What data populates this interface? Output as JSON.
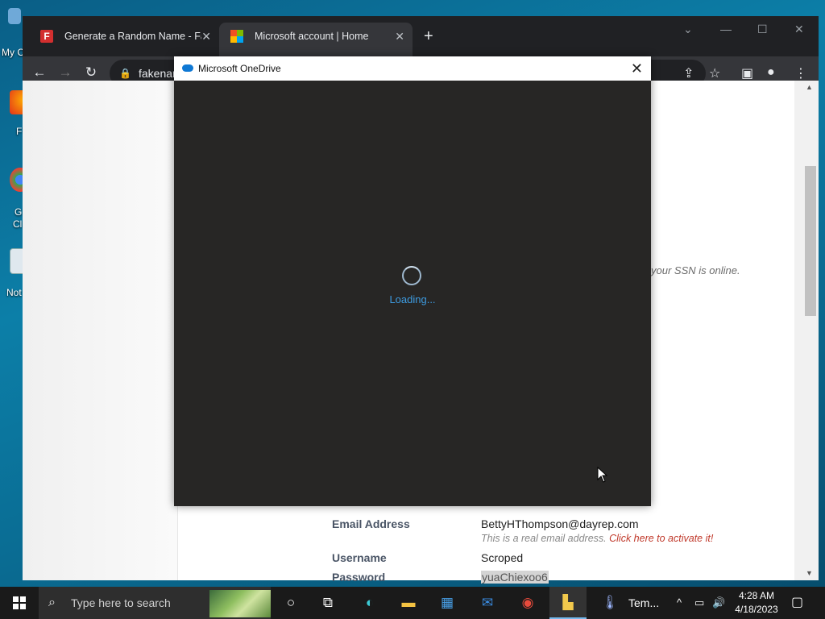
{
  "desktop": {
    "icons": [
      {
        "label": "My C"
      },
      {
        "label": "F"
      },
      {
        "label": "G"
      },
      {
        "label": "Cl"
      },
      {
        "label": "Not"
      }
    ]
  },
  "browser": {
    "tabs": [
      {
        "title": "Generate a Random Name - Fake",
        "favicon": "fakename-f-icon",
        "active": false
      },
      {
        "title": "Microsoft account | Home",
        "favicon": "microsoft-logo-icon",
        "active": true
      }
    ],
    "new_tab": "+",
    "address": "fakenar",
    "page": {
      "ssn_note": "your SSN is online.",
      "email_label": "Email Address",
      "email_value": "BettyHThompson@dayrep.com",
      "email_note": "This is a real email address.",
      "email_link": "Click here to activate it!",
      "username_label": "Username",
      "username_value": "Scroped",
      "password_label": "Password",
      "password_value": "yuaChiexoo6"
    }
  },
  "dialog": {
    "title": "Microsoft OneDrive",
    "loading_text": "Loading..."
  },
  "taskbar": {
    "search_placeholder": "Type here to search",
    "temp_app_label": "Tem...",
    "time": "4:28 AM",
    "date": "4/18/2023"
  },
  "colors": {
    "accent_blue": "#3d9be0",
    "link_red": "#c0392b",
    "dialog_body": "#272625"
  }
}
